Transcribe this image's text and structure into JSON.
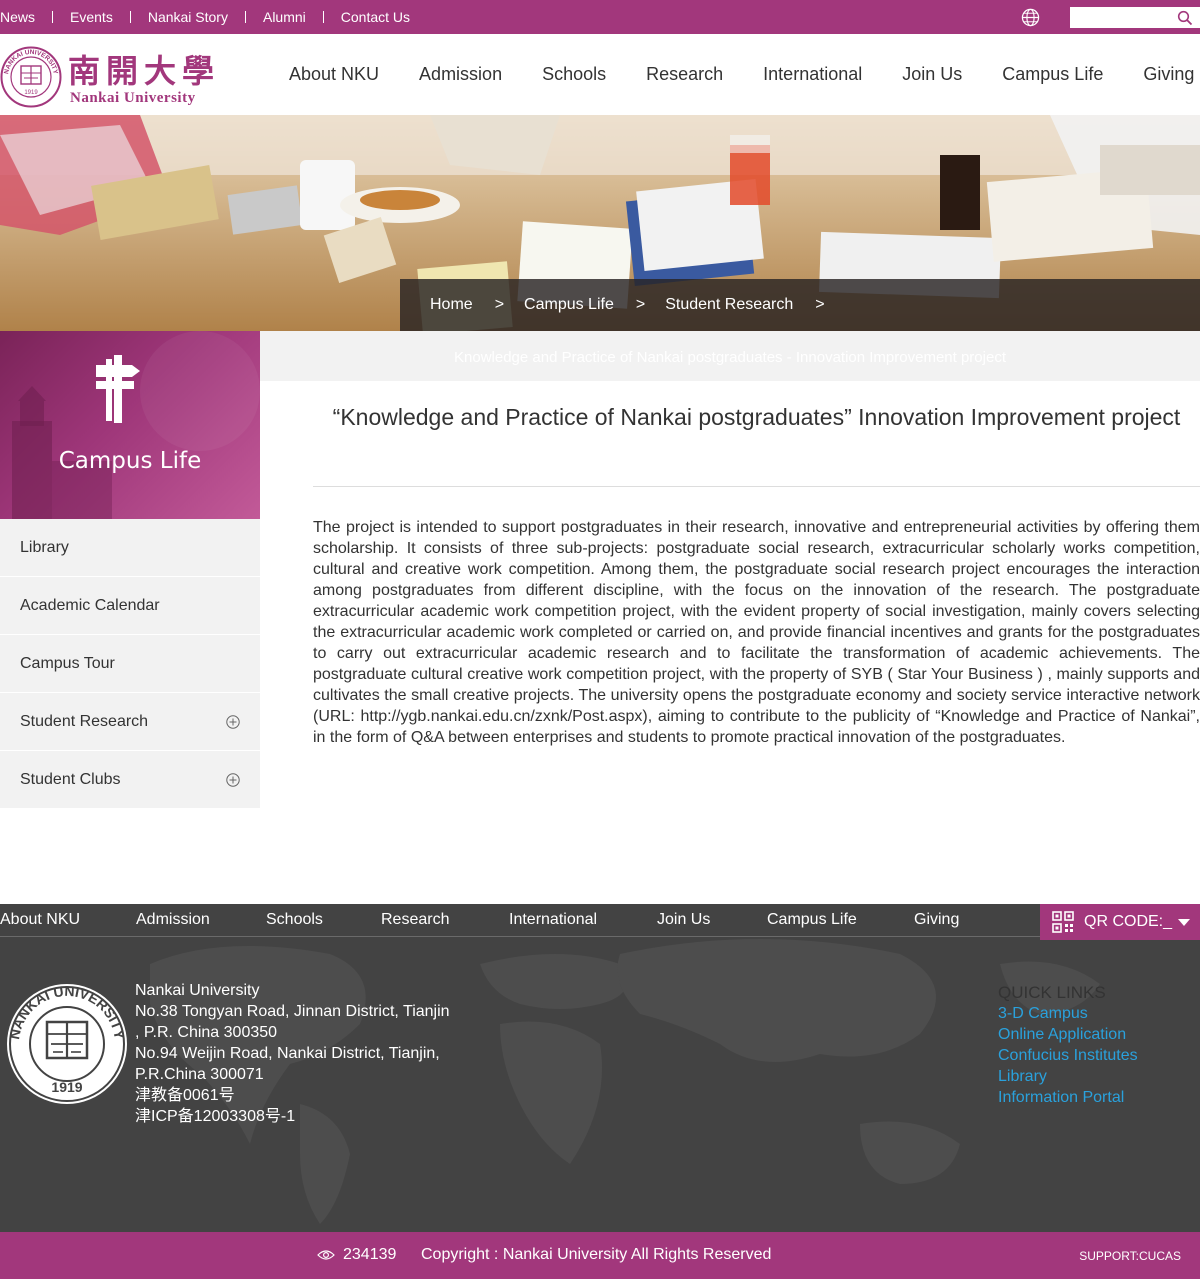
{
  "topbar": {
    "links": [
      "News",
      "Events",
      "Nankai Story",
      "Alumni",
      "Contact Us"
    ],
    "search_placeholder": ""
  },
  "header": {
    "logo_cn": "南開大學",
    "logo_en": "Nankai University",
    "seal_text": "NANKAI UNIVERSITY",
    "seal_year": "1919",
    "nav": [
      "About NKU",
      "Admission",
      "Schools",
      "Research",
      "International",
      "Join Us",
      "Campus Life",
      "Giving"
    ]
  },
  "breadcrumb": [
    "Home",
    "Campus Life",
    "Student Research"
  ],
  "breadcrumb_sep": ">",
  "sidebar": {
    "title": "Campus Life",
    "items": [
      {
        "label": "Library",
        "expandable": false
      },
      {
        "label": "Academic Calendar",
        "expandable": false
      },
      {
        "label": "Campus Tour",
        "expandable": false
      },
      {
        "label": "Student Research",
        "expandable": true
      },
      {
        "label": "Student Clubs",
        "expandable": true
      }
    ]
  },
  "content": {
    "strip_title": "Knowledge and Practice of Nankai postgraduates - Innovation Improvement project",
    "title": "“Knowledge and Practice of Nankai postgraduates” Innovation Improvement project",
    "body": "The project is intended to support postgraduates in their research, innovative and entrepreneurial activities by offering them scholarship. It consists of three sub-projects: postgraduate social research, extracurricular scholarly works competition, cultural and creative work competition. Among them, the postgraduate social research project encourages the interaction among postgraduates from different discipline, with the focus on the innovation of the research. The postgraduate extracurricular academic work competition project, with the evident property of social investigation, mainly covers selecting the extracurricular academic work completed or carried on, and provide financial incentives and grants for the postgraduates to carry out extracurricular academic research and to facilitate the transformation of academic achievements. The postgraduate cultural creative work competition project, with the property of SYB ( Star Your Business ) , mainly supports and cultivates the small creative projects. The university opens the postgraduate economy and society service interactive network (URL: http://ygb.nankai.edu.cn/zxnk/Post.aspx), aiming to contribute to the publicity of “Knowledge and Practice of Nankai”, in the form of Q&A between enterprises and students to promote practical innovation of the postgraduates."
  },
  "footer": {
    "nav": [
      "About NKU",
      "Admission",
      "Schools",
      "Research",
      "International",
      "Join Us",
      "Campus Life",
      "Giving"
    ],
    "qr_label": "QR CODE:_",
    "address_lines": [
      "Nankai University",
      "No.38 Tongyan Road, Jinnan District, Tianjin",
      ", P.R. China 300350",
      "No.94 Weijin Road,  Nankai District, Tianjin,",
      "P.R.China  300071",
      "津教备0061号",
      "津ICP备12003308号-1"
    ],
    "quick_links_title": "QUICK LINKS",
    "quick_links": [
      "3-D Campus",
      "Online Application",
      "Confucius Institutes",
      "Library",
      "Information Portal"
    ],
    "seal_text": "NANKAI UNIVERSITY",
    "seal_year": "1919"
  },
  "bottombar": {
    "visits": "234139",
    "copyright": "Copyright : Nankai University All Rights Reserved",
    "support": "SUPPORT:CUCAS"
  },
  "colors": {
    "brand": "#a2377c",
    "footer_bg": "#434343",
    "link": "#2aa1dc"
  }
}
